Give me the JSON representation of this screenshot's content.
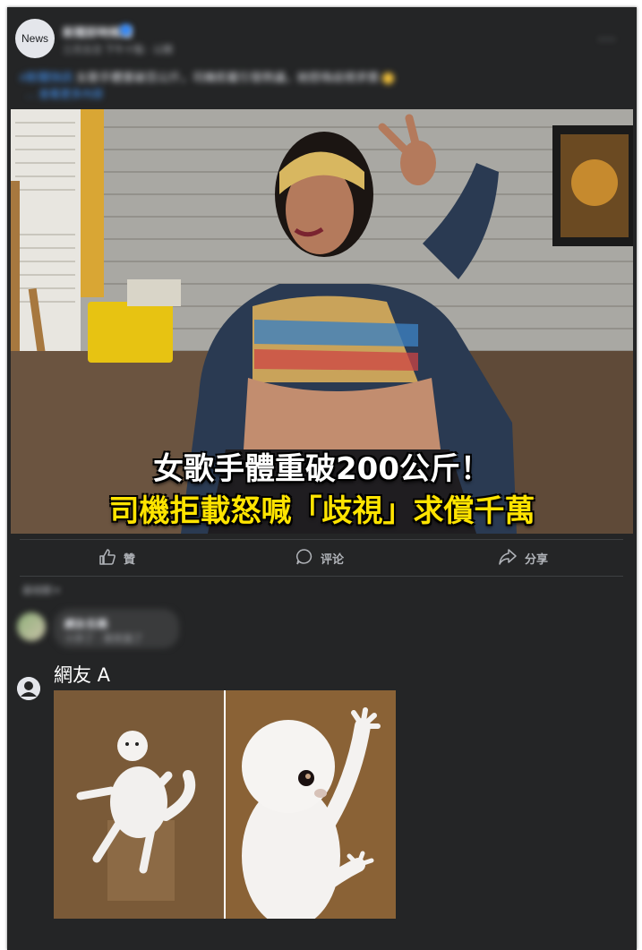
{
  "post": {
    "avatar_label": "News",
    "page_name": "新聞即時頻道",
    "meta": "三月五日 下午十點 · 公開",
    "caption_tag": "#新聞快訊",
    "caption_text": " 女歌手體重破百公斤，司機拒載引發熱議，她怒喚歧視求償",
    "caption_link": "… 查看更多內容",
    "headline_1": "女歌手體重破200公斤！",
    "headline_2": "司機拒載怒喊「歧視」求償千萬"
  },
  "actions": {
    "like_label": "贊",
    "comment_label": "评论",
    "share_label": "分享"
  },
  "comments": {
    "sort_label": "最相關 ▾",
    "first_comment": {
      "name": "網友名稱",
      "text": "十炸了 · 笑死我了"
    },
    "netizen": {
      "name": "網友 A"
    }
  },
  "colors": {
    "card_bg": "#242526",
    "headline_white": "#ffffff",
    "headline_yellow": "#ffe400",
    "link_blue": "#4599ff"
  }
}
